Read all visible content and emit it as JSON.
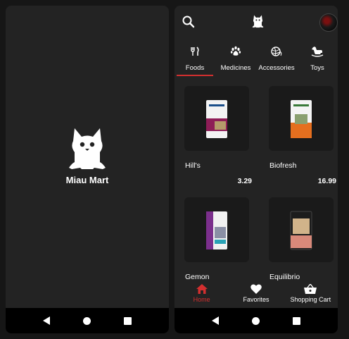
{
  "splash": {
    "app_name": "Miau Mart"
  },
  "tabs": [
    {
      "label": "Foods",
      "icon": "fork-knife-icon",
      "active": true
    },
    {
      "label": "Medicines",
      "icon": "paw-icon",
      "active": false
    },
    {
      "label": "Accessories",
      "icon": "yarn-ball-icon",
      "active": false
    },
    {
      "label": "Toys",
      "icon": "rocking-horse-icon",
      "active": false
    }
  ],
  "products": [
    {
      "name": "Hill's",
      "price": "3.29"
    },
    {
      "name": "Biofresh",
      "price": "16.99"
    },
    {
      "name": "Gemon",
      "price": ""
    },
    {
      "name": "Equilibrio",
      "price": ""
    }
  ],
  "bottom_nav": [
    {
      "label": "Home",
      "icon": "home-icon",
      "active": true
    },
    {
      "label": "Favorites",
      "icon": "heart-icon",
      "active": false
    },
    {
      "label": "Shopping Cart",
      "icon": "basket-icon",
      "active": false
    }
  ],
  "colors": {
    "accent": "#d32f2f",
    "background": "#232323",
    "card": "#1a1a1a"
  }
}
